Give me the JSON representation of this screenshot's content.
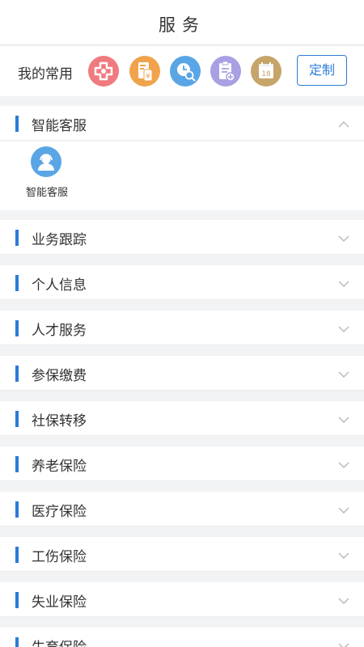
{
  "header": {
    "title": "服务"
  },
  "common": {
    "label": "我的常用",
    "icons": [
      {
        "name": "medical-cross-icon",
        "color": "#ef7a7f"
      },
      {
        "name": "bill-yuan-icon",
        "color": "#f0a34c"
      },
      {
        "name": "clock-search-icon",
        "color": "#5aa5e6"
      },
      {
        "name": "clipboard-add-icon",
        "color": "#a7a0e3"
      },
      {
        "name": "calendar-icon",
        "color": "#c6a46a"
      }
    ],
    "calendar_day": "18",
    "custom_label": "定制"
  },
  "expanded_section": {
    "title": "智能客服",
    "items": [
      {
        "label": "智能客服",
        "icon": "customer-service-icon"
      }
    ]
  },
  "sections": [
    {
      "title": "业务跟踪"
    },
    {
      "title": "个人信息"
    },
    {
      "title": "人才服务"
    },
    {
      "title": "参保缴费"
    },
    {
      "title": "社保转移"
    },
    {
      "title": "养老保险"
    },
    {
      "title": "医疗保险"
    },
    {
      "title": "工伤保险"
    },
    {
      "title": "失业保险"
    },
    {
      "title": "生育保险"
    }
  ],
  "colors": {
    "accent": "#2d7bd6"
  }
}
